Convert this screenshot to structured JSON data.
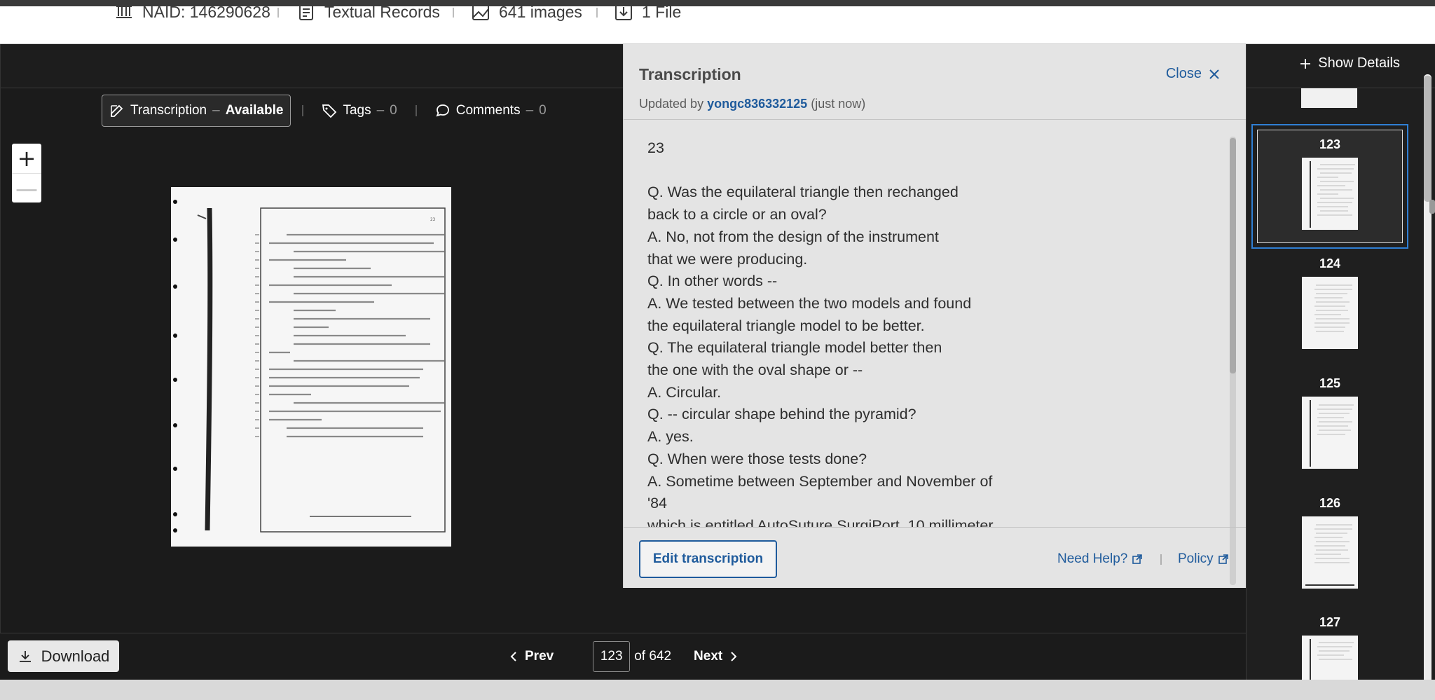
{
  "meta": {
    "naid": "NAID: 146290628",
    "record_type": "Textual Records",
    "images": "641 images",
    "files": "1 File"
  },
  "tabs": {
    "transcription": "Transcription",
    "transcription_sep": "–",
    "transcription_status": "Available",
    "tags": "Tags",
    "tags_sep": "–",
    "tags_count": "0",
    "comments": "Comments",
    "comments_sep": "–",
    "comments_count": "0"
  },
  "zoom": {
    "in": "+",
    "out": "—"
  },
  "transcription": {
    "title": "Transcription",
    "close": "Close",
    "updated_prefix": "Updated by",
    "updated_user": "yongc836332125",
    "updated_suffix": "(just now)",
    "lines": [
      "23",
      "",
      "Q. Was the equilateral triangle then rechanged",
      "back to a circle or an oval?",
      "A. No, not from the design of the instrument",
      "that we were producing.",
      "Q. In other words --",
      "A. We tested between the two models and found",
      "the equilateral triangle model to be better.",
      "Q. The equilateral triangle model better then",
      "the one with the oval shape or --",
      "A. Circular.",
      "Q. -- circular shape behind the pyramid?",
      "A. yes.",
      "Q. When were those tests done?",
      "A. Sometime between September and November of",
      "'84",
      "which is entitled AutoSuture SurgiPort, 10 millimeter"
    ],
    "edit_label": "Edit transcription",
    "help_label": "Need Help?",
    "policy_label": "Policy"
  },
  "pager": {
    "prev": "Prev",
    "current": "123",
    "of_total": "of 642",
    "next": "Next"
  },
  "download_label": "Download",
  "sidebar": {
    "show_details": "Show Details",
    "thumbs": [
      {
        "num": "123",
        "active": true
      },
      {
        "num": "124",
        "active": false
      },
      {
        "num": "125",
        "active": false
      },
      {
        "num": "126",
        "active": false
      },
      {
        "num": "127",
        "active": false
      }
    ]
  },
  "colors": {
    "accent": "#1f5b9c",
    "selection": "#2f7fd4",
    "viewer_bg": "#1b1b1b",
    "panel_bg": "#e4e4e4"
  }
}
